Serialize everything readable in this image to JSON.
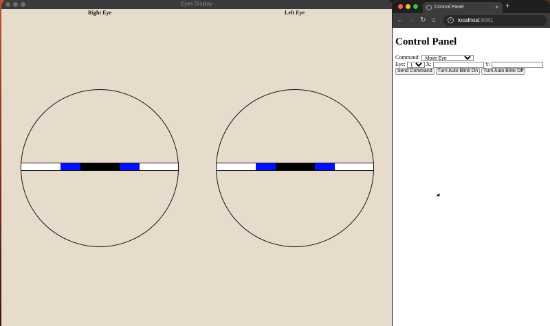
{
  "eyes_window": {
    "title": "Eyes Display",
    "right_eye_label": "Right Eye",
    "left_eye_label": "Left Eye",
    "colors": {
      "background": "#e7dccb",
      "iris": "#0010ff",
      "pupil": "#000000"
    }
  },
  "browser": {
    "tab_title": "Control Panel",
    "tab_close": "×",
    "new_tab": "+",
    "address_host": "localhost",
    "address_port": ":8081",
    "icons": {
      "back": "←",
      "forward": "→",
      "reload": "↻",
      "home": "⌂",
      "info": "i"
    },
    "page": {
      "heading": "Control Panel",
      "command_label": "Command:",
      "command_value": "Move Eye",
      "eye_label": "Eye:",
      "eye_value": "Left",
      "x_label": "X:",
      "x_value": "",
      "y_label": "Y:",
      "y_value": "",
      "send_button": "Send Command",
      "blink_on_button": "Turn Auto Blink On",
      "blink_off_button": "Turn Auto Blink Off"
    }
  }
}
